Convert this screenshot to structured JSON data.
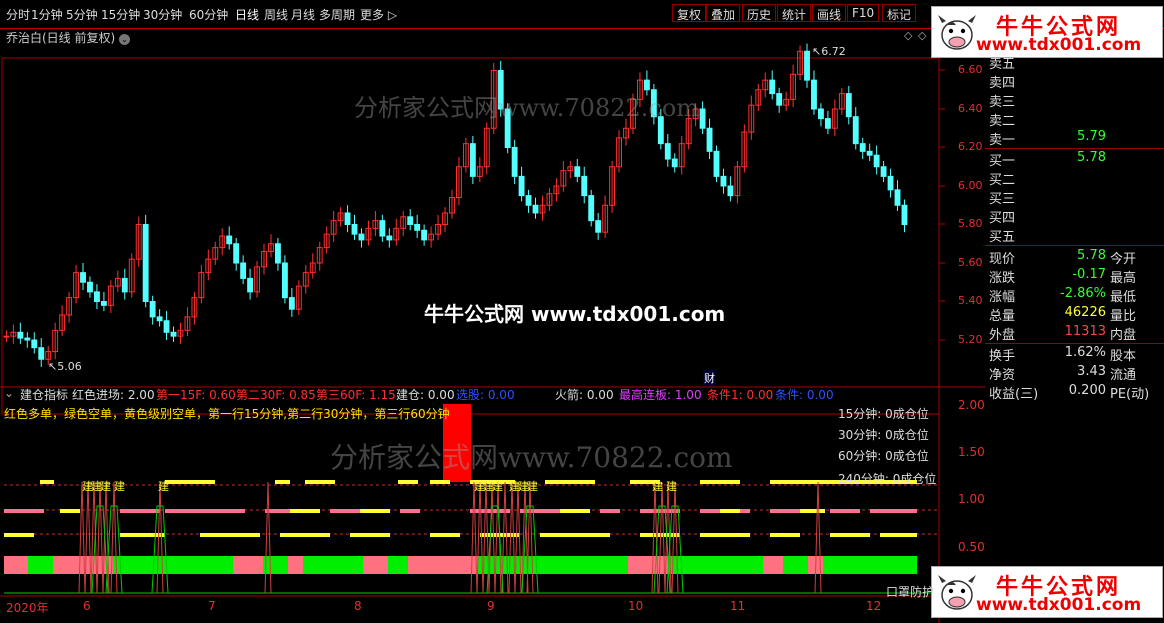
{
  "toolbar": {
    "periods": [
      "分时",
      "1分钟",
      "5分钟",
      "15分钟",
      "30分钟",
      "60分钟",
      "日线",
      "周线",
      "月线",
      "多周期",
      "更多"
    ],
    "buttons": [
      "复权",
      "叠加",
      "历史",
      "统计",
      "画线",
      "F10",
      "标记"
    ]
  },
  "stock": {
    "title": "乔治白(日线 前复权)"
  },
  "price_axis": [
    "6.60",
    "6.40",
    "6.20",
    "6.00",
    "5.80",
    "5.60",
    "5.40",
    "5.20"
  ],
  "annotations": {
    "high": "6.72",
    "low": "5.06",
    "cai": "财"
  },
  "watermark": {
    "main": "分析家公式网www.70822.com",
    "center": "牛牛公式网 www.tdx001.com"
  },
  "logo": {
    "title": "牛牛公式网",
    "url": "www.tdx001.com"
  },
  "quote": {
    "sell": [
      {
        "label": "卖五",
        "value": ""
      },
      {
        "label": "卖四",
        "value": ""
      },
      {
        "label": "卖三",
        "value": ""
      },
      {
        "label": "卖二",
        "value": ""
      },
      {
        "label": "卖一",
        "value": "5.79"
      }
    ],
    "buy": [
      {
        "label": "买一",
        "value": "5.78"
      },
      {
        "label": "买二",
        "value": ""
      },
      {
        "label": "买三",
        "value": ""
      },
      {
        "label": "买四",
        "value": ""
      },
      {
        "label": "买五",
        "value": ""
      }
    ],
    "stats": [
      {
        "label": "现价",
        "value": "5.78",
        "color": "#33ff33",
        "right": "今开"
      },
      {
        "label": "涨跌",
        "value": "-0.17",
        "color": "#33ff33",
        "right": "最高"
      },
      {
        "label": "涨幅",
        "value": "-2.86%",
        "color": "#33ff33",
        "right": "最低"
      },
      {
        "label": "总量",
        "value": "46226",
        "color": "#ffff33",
        "right": "量比"
      },
      {
        "label": "外盘",
        "value": "11313",
        "color": "#ff4444",
        "right": "内盘"
      }
    ],
    "stats2": [
      {
        "label": "换手",
        "value": "1.62%",
        "color": "#dddddd",
        "right": "股本"
      },
      {
        "label": "净资",
        "value": "3.43",
        "color": "#dddddd",
        "right": "流通"
      },
      {
        "label": "收益(三)",
        "value": "0.200",
        "color": "#dddddd",
        "right": "PE(动)"
      }
    ]
  },
  "indicator": {
    "name": "建仓指标",
    "items": [
      {
        "text": "红色进场: 2.00",
        "color": "#dddddd"
      },
      {
        "text": "第一15F: 0.60",
        "color": "#ff3030"
      },
      {
        "text": "第二30F: 0.85",
        "color": "#ff3030"
      },
      {
        "text": "第三60F: 1.15",
        "color": "#ff3030"
      },
      {
        "text": "建仓: 0.00",
        "color": "#dddddd"
      },
      {
        "text": "选股: 0.00",
        "color": "#3050ff"
      },
      {
        "text": "火箭: 0.00",
        "color": "#dddddd"
      },
      {
        "text": "最高连板: 1.00",
        "color": "#e040ff"
      },
      {
        "text": "条件1: 0.00",
        "color": "#ff3030"
      },
      {
        "text": "条件: 0.00",
        "color": "#3050ff"
      }
    ],
    "description": "红色多单，绿色空单，黄色级别空单，第一行15分钟,第二行30分钟，第三行60分钟",
    "positions": [
      "15分钟: 0成仓位",
      "30分钟: 0成仓位",
      "60分钟: 0成仓位",
      "240分钟: 0成仓位"
    ],
    "axis": [
      "2.00",
      "1.50",
      "1.00",
      "0.50"
    ],
    "bottom_text": "口罩防护",
    "signal": "建"
  },
  "dates": [
    "2020年",
    "6",
    "7",
    "8",
    "9",
    "10",
    "11",
    "12"
  ]
}
